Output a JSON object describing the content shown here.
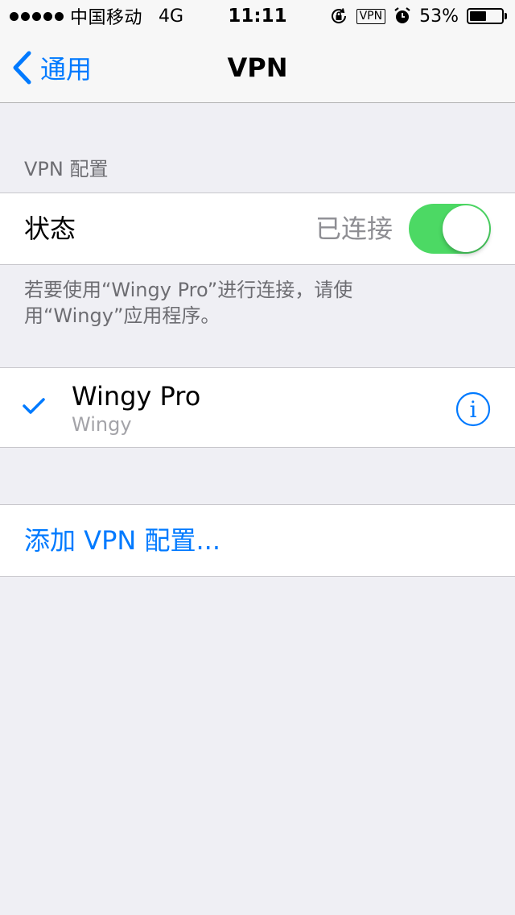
{
  "status_bar": {
    "carrier": "中国移动",
    "network": "4G",
    "time": "11:11",
    "vpn_badge": "VPN",
    "battery_percent": "53%",
    "battery_level": 0.53,
    "icons": [
      "orientation-lock-icon",
      "alarm-icon"
    ]
  },
  "nav": {
    "back_label": "通用",
    "title": "VPN"
  },
  "vpn_section": {
    "header": "VPN 配置",
    "status_label": "状态",
    "status_value": "已连接",
    "toggle_on": true,
    "footer": "若要使用“Wingy Pro”进行连接，请使用“Wingy”应用程序。"
  },
  "profiles": [
    {
      "name": "Wingy Pro",
      "subtitle": "Wingy",
      "selected": true
    }
  ],
  "add_config_label": "添加 VPN 配置...",
  "colors": {
    "accent": "#007aff",
    "toggle_on": "#4cd964",
    "background": "#efeff4"
  }
}
